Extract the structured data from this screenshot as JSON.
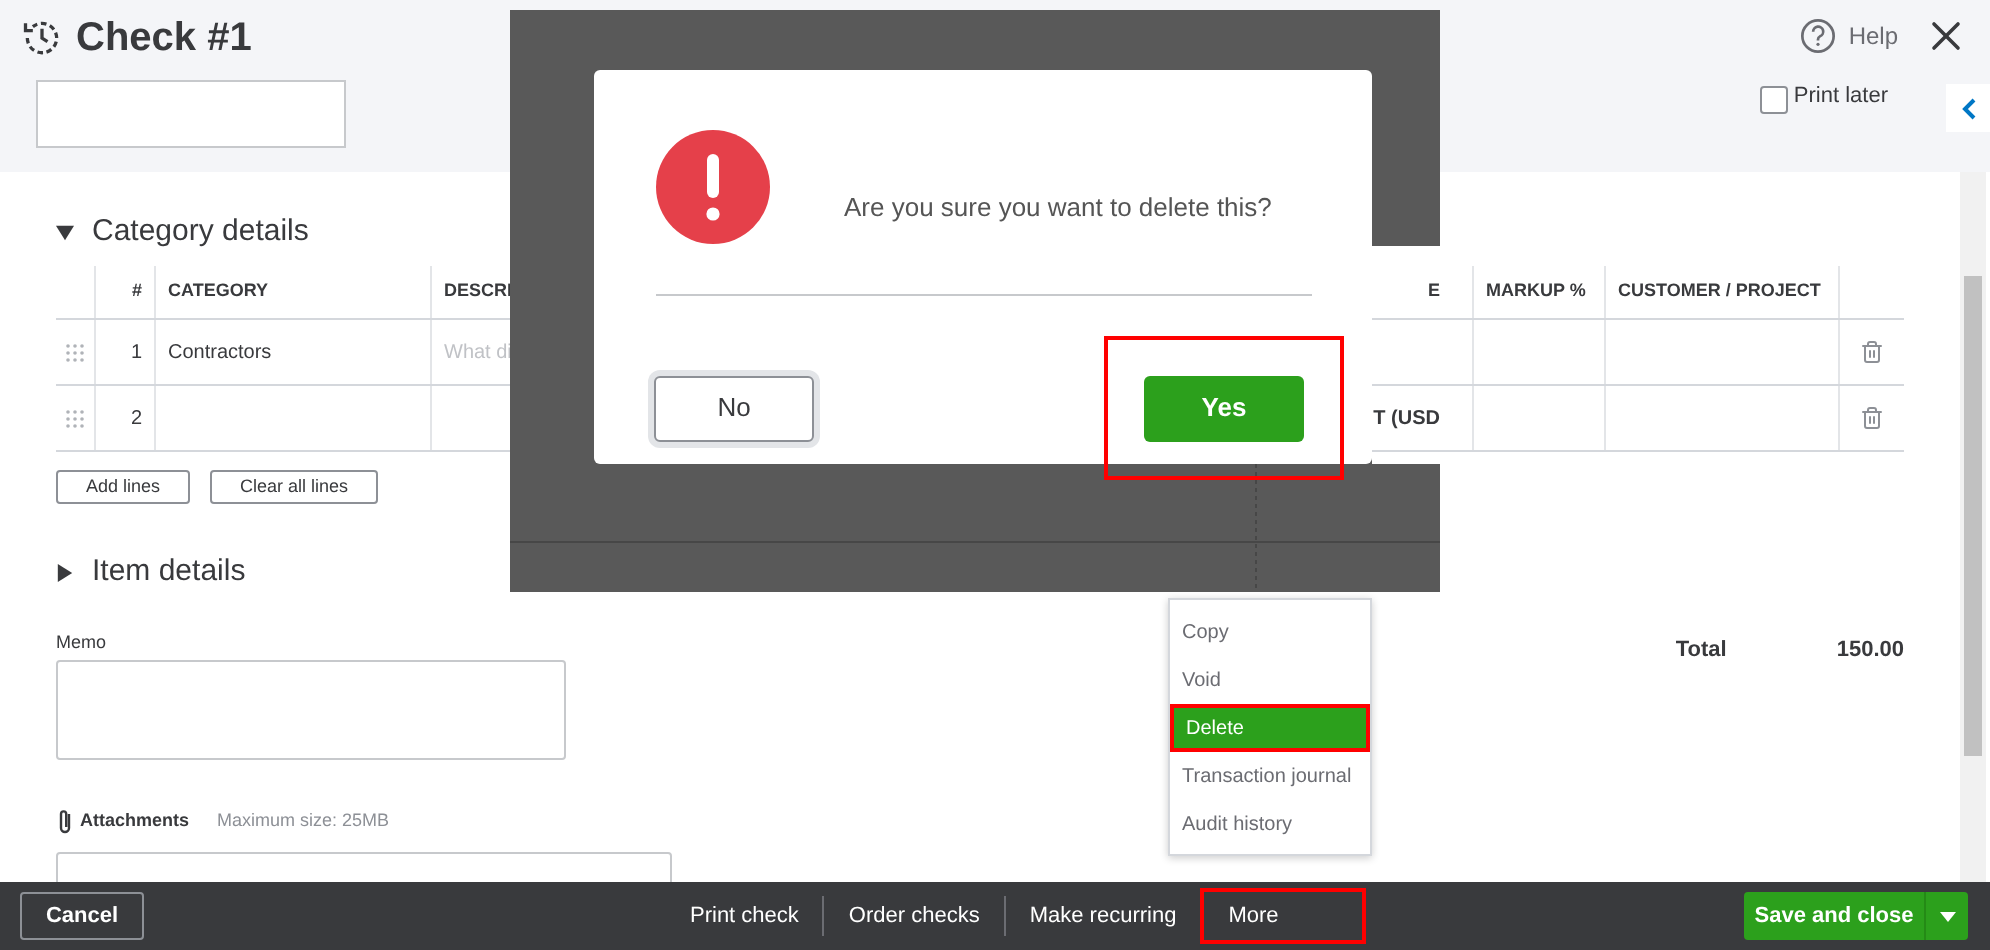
{
  "header": {
    "title": "Check #1",
    "help": "Help",
    "print_later": {
      "label": "Print later",
      "checked": false
    }
  },
  "category_details": {
    "title": "Category details",
    "expanded": true,
    "columns": [
      "#",
      "CATEGORY",
      "DESCRI",
      "E",
      "MARKUP %",
      "CUSTOMER / PROJECT"
    ],
    "rows": [
      {
        "number": "1",
        "category": "Contractors",
        "description": {
          "placeholder": "What di"
        }
      },
      {
        "number": "2",
        "column_4": "T (USD"
      }
    ],
    "buttons": [
      "Add lines",
      "Clear all lines"
    ]
  },
  "item_details": {
    "title": "Item details",
    "expanded": false
  },
  "memo": {
    "label": "Memo"
  },
  "attachments": {
    "label": "Attachments",
    "hint": "Maximum size: 25MB"
  },
  "total": {
    "label": "Total",
    "value": "150.00"
  },
  "footer": {
    "cancel": "Cancel",
    "actions": [
      {
        "label": "Print check",
        "separated": false,
        "highlighted": false
      },
      {
        "label": "Order checks",
        "separated": true,
        "highlighted": false
      },
      {
        "label": "Make recurring",
        "separated": true,
        "highlighted": false
      },
      {
        "label": "More",
        "separated": false,
        "highlighted": true
      }
    ],
    "save": "Save and close"
  },
  "more_menu": {
    "items": [
      {
        "label": "Copy",
        "selected": false,
        "highlighted": false
      },
      {
        "label": "Void",
        "selected": false,
        "highlighted": false
      },
      {
        "label": "Delete",
        "selected": true,
        "highlighted": true
      },
      {
        "label": "Transaction journal",
        "selected": false,
        "highlighted": false
      },
      {
        "label": "Audit history",
        "selected": false,
        "highlighted": false
      }
    ]
  },
  "dialog": {
    "message": "Are you sure you want to delete this?",
    "buttons": [
      {
        "label": "No",
        "kind": "secondary",
        "highlighted": false
      },
      {
        "label": "Yes",
        "kind": "primary",
        "highlighted": true
      }
    ]
  }
}
